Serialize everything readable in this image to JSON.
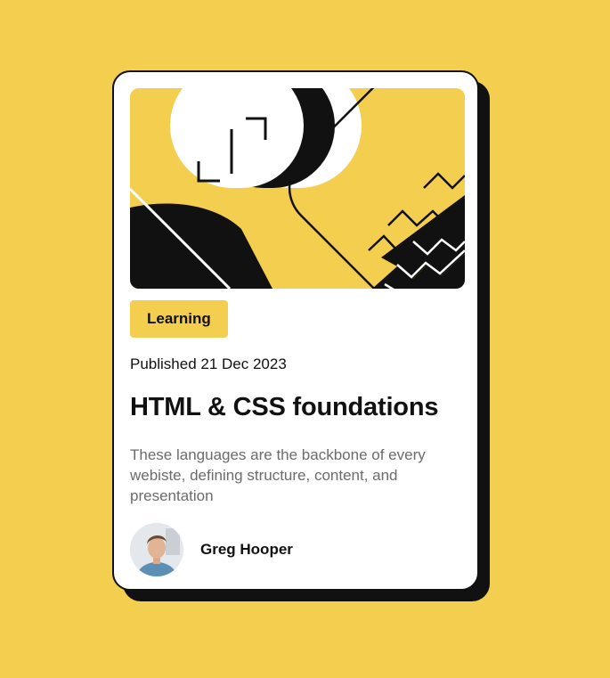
{
  "colors": {
    "page_background": "#F4CE4F",
    "card_background": "#FFFFFF",
    "ink": "#111111",
    "muted_text": "#6B6B6B",
    "tag_background": "#F4CE4F"
  },
  "card": {
    "hero_image": "abstract-geometric-illustration",
    "tag": "Learning",
    "published": "Published 21 Dec 2023",
    "title": "HTML & CSS foundations",
    "description": "These languages are the backbone of every webiste, defining structure, content, and presentation",
    "author": {
      "avatar_icon": "author-avatar",
      "name": "Greg Hooper"
    }
  }
}
